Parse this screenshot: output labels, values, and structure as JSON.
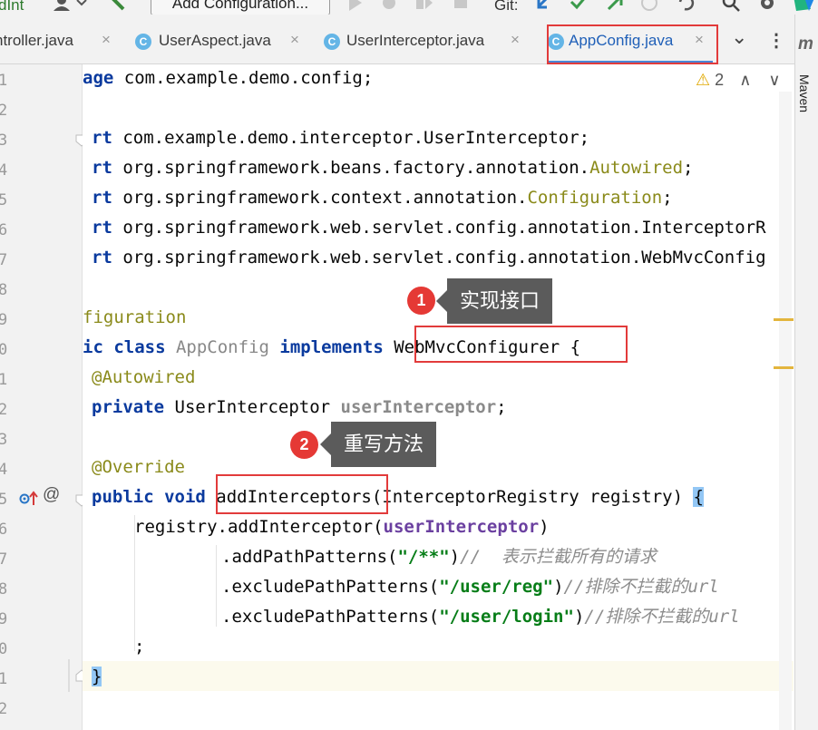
{
  "toolbar": {
    "config_partial": "dInt",
    "add_configuration": "Add Configuration...",
    "git_label": "Git:"
  },
  "tabs": [
    {
      "label": "ntroller.java",
      "close": "×"
    },
    {
      "label": "UserAspect.java",
      "close": "×",
      "icon": "C"
    },
    {
      "label": "UserInterceptor.java",
      "close": "×",
      "icon": "C"
    },
    {
      "label": "AppConfig.java",
      "close": "×",
      "icon": "C",
      "active": true
    }
  ],
  "tabbar_more": "⌄",
  "tabbar_menu": "⋮",
  "right_strip": {
    "m": "m",
    "maven": "Maven"
  },
  "inspections": {
    "count": "2",
    "up": "∧",
    "down": "∨"
  },
  "line_numbers": [
    "1",
    "2",
    "3",
    "4",
    "5",
    "6",
    "7",
    "8",
    "9",
    "0",
    "1",
    "2",
    "3",
    "4",
    "5",
    "6",
    "7",
    "8",
    "9",
    "0",
    "1",
    "2"
  ],
  "code": {
    "l1": {
      "a": "age",
      "b": " com.example.demo.config;"
    },
    "l3": {
      "a": "rt",
      "b": " com.example.demo.interceptor.UserInterceptor;"
    },
    "l4": {
      "a": "rt",
      "b": " org.springframework.beans.factory.annotation.",
      "c": "Autowired",
      "d": ";"
    },
    "l5": {
      "a": "rt",
      "b": " org.springframework.context.annotation.",
      "c": "Configuration",
      "d": ";"
    },
    "l6": {
      "a": "rt",
      "b": " org.springframework.web.servlet.config.annotation.InterceptorR"
    },
    "l7": {
      "a": "rt",
      "b": " org.springframework.web.servlet.config.annotation.WebMvcConfig"
    },
    "l9": {
      "a": "figuration"
    },
    "l10": {
      "a": "ic class",
      "b": " ",
      "c": "AppConfig",
      "d": " ",
      "e": "implements",
      "f": " WebMvcConfigurer {"
    },
    "l11": {
      "a": "@Autowired"
    },
    "l12": {
      "a": "private",
      "b": " UserInterceptor ",
      "c": "userInterceptor",
      "d": ";"
    },
    "l14": {
      "a": "@Override"
    },
    "l15": {
      "a": "public void",
      "b": " addInterceptors(InterceptorRegistry registry) ",
      "c": "{"
    },
    "l16": {
      "a": "registry.addInterceptor(",
      "b": "userInterceptor",
      "c": ")"
    },
    "l17": {
      "a": ".addPathPatterns(",
      "b": "\"/**\"",
      "c": ")",
      "d": "//  表示拦截所有的请求"
    },
    "l18": {
      "a": ".excludePathPatterns(",
      "b": "\"/user/reg\"",
      "c": ")",
      "d": "//排除不拦截的url"
    },
    "l19": {
      "a": ".excludePathPatterns(",
      "b": "\"/user/login\"",
      "c": ")",
      "d": "//排除不拦截的url"
    },
    "l20": {
      "a": ";"
    },
    "l21": {
      "a": "}"
    }
  },
  "annotations": [
    {
      "number": "1",
      "text": "实现接口"
    },
    {
      "number": "2",
      "text": "重写方法"
    }
  ],
  "colors": {
    "highlight": "#e23b3b",
    "callout_bg": "#5b5b5b",
    "badge": "#e53935",
    "keyword": "#0a3a9e",
    "string": "#067d17"
  }
}
